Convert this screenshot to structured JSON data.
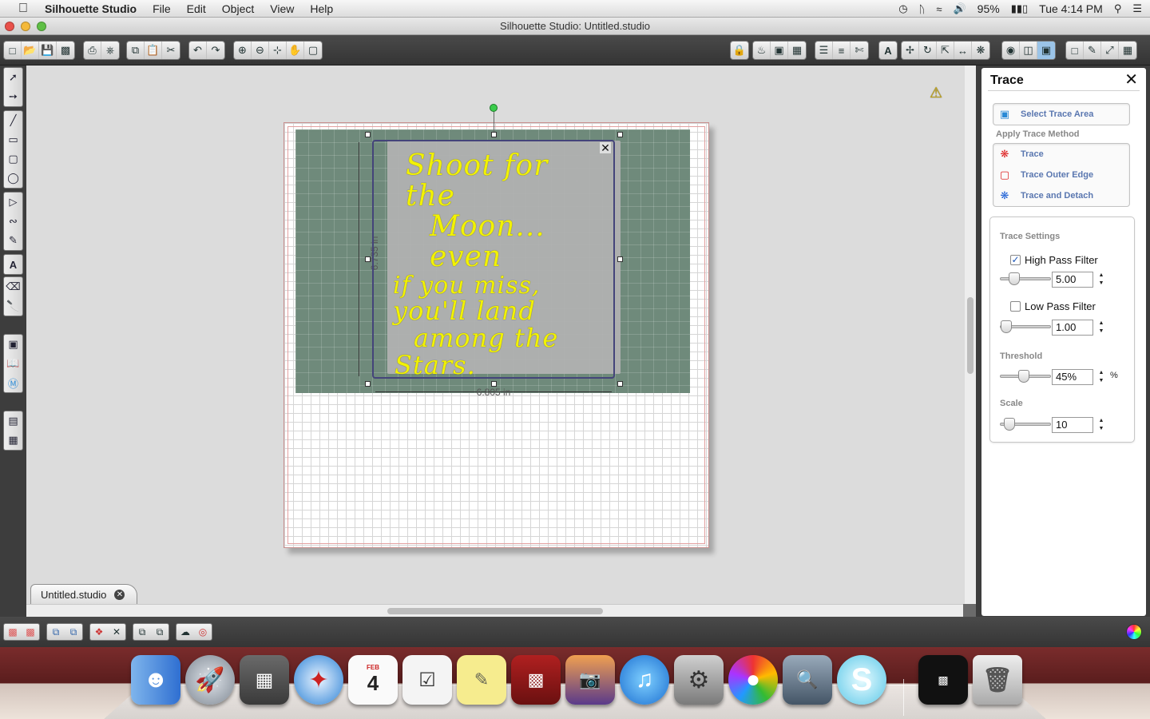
{
  "menubar": {
    "app_name": "Silhouette Studio",
    "menus": [
      "File",
      "Edit",
      "Object",
      "View",
      "Help"
    ],
    "battery": "95%",
    "clock": "Tue 4:14 PM"
  },
  "window": {
    "title": "Silhouette Studio: Untitled.studio"
  },
  "canvas": {
    "quote_lines": [
      "Shoot for the",
      "Moon... even",
      "if you miss,",
      "you'll land",
      "among the",
      "Stars."
    ],
    "dim_height": "6.735 in",
    "dim_width": "6.805 in"
  },
  "document_tab": {
    "label": "Untitled.studio"
  },
  "trace_panel": {
    "title": "Trace",
    "select_area_label": "Select Trace Area",
    "apply_method_heading": "Apply Trace Method",
    "methods": [
      "Trace",
      "Trace Outer Edge",
      "Trace and Detach"
    ],
    "settings_heading": "Trace Settings",
    "high_pass": {
      "label": "High Pass Filter",
      "checked": true,
      "value": "5.00"
    },
    "low_pass": {
      "label": "Low Pass Filter",
      "checked": false,
      "value": "1.00"
    },
    "threshold": {
      "label": "Threshold",
      "value": "45%",
      "unit": "%"
    },
    "scale": {
      "label": "Scale",
      "value": "10"
    }
  },
  "dock": {
    "calendar_month": "FEB",
    "calendar_day": "4"
  },
  "colors": {
    "trace_yellow": "#f2f200",
    "mat_photo": "#6f8a7b",
    "panel_link": "#5a77b0",
    "dark_chrome": "#3d3d3d"
  }
}
